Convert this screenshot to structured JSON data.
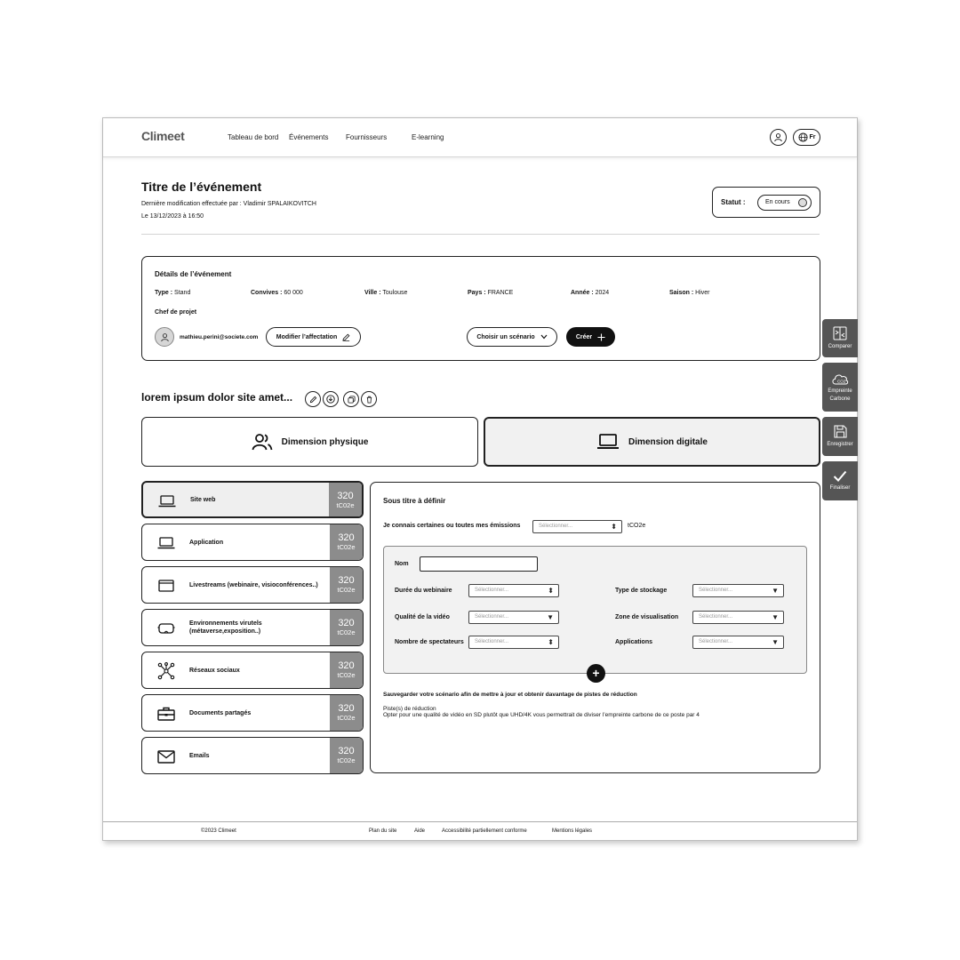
{
  "header": {
    "logo": "Climeet",
    "nav": [
      "Tableau de bord",
      "Événements",
      "Fournisseurs",
      "E-learning"
    ],
    "lang": "Fr"
  },
  "event": {
    "title": "Titre de l’événement",
    "modified_by": "Dernière modification effectuée par : Vladimir SPALAIKOVITCH",
    "date": "Le 13/12/2023 à 16:50",
    "status_label": "Statut :",
    "status_value": "En cours"
  },
  "details": {
    "title": "Détails de l’événement",
    "items": [
      {
        "key": "Type :",
        "value": " Stand"
      },
      {
        "key": "Convives :",
        "value": " 60 000"
      },
      {
        "key": "Ville :",
        "value": " Toulouse"
      },
      {
        "key": "Pays :",
        "value": " FRANCE"
      },
      {
        "key": "Année :",
        "value": " 2024"
      },
      {
        "key": "Saison :",
        "value": " Hiver"
      }
    ],
    "chef_label": "Chef de projet",
    "email": "mathieu.perini@societe.com",
    "modify_label": "Modifier l’affectation",
    "scenario_label": "Choisir un scénario",
    "create_label": "Créer"
  },
  "scenario": {
    "title": "lorem ipsum dolor site amet..."
  },
  "dimensions": {
    "physique": "Dimension physique",
    "digitale": "Dimension digitale"
  },
  "categories": [
    {
      "label": "Site web",
      "value": "320",
      "unit": "tC02e"
    },
    {
      "label": "Application",
      "value": "320",
      "unit": "tC02e"
    },
    {
      "label": "Livestreams (webinaire, visioconférences..)",
      "value": "320",
      "unit": "tC02e"
    },
    {
      "label": "Environnements virutels (métaverse,exposition..)",
      "value": "320",
      "unit": "tC02e"
    },
    {
      "label": "Réseaux sociaux",
      "value": "320",
      "unit": "tC02e"
    },
    {
      "label": "Documents partagés",
      "value": "320",
      "unit": "tC02e"
    },
    {
      "label": "Emails",
      "value": "320",
      "unit": "tC02e"
    }
  ],
  "panel": {
    "subtitle": "Sous titre à définir",
    "know_label": "Je connais certaines ou toutes mes émissions",
    "select_placeholder": "Sélectionner...",
    "unit": "tCO2e",
    "nom_label": "Nom",
    "fields": {
      "duree": "Durée du webinaire",
      "qualite": "Qualité de la vidéo",
      "spectateurs": "Nombre de spectateurs",
      "stockage": "Type de stockage",
      "zone": "Zone de visualisation",
      "applications": "Applications"
    },
    "field_placeholder": "Sélectionner...",
    "save_text": "Sauvegarder votre scénario afin de mettre à jour et obtenir davantage de pistes de réduction",
    "piste_title": "Piste(s) de réduction",
    "piste_text": "Opter pour une qualité de vidéo en SD plutôt que UHD/4K vous permettrait de diviser l’empreinte carbone de ce poste par 4"
  },
  "footer": {
    "copyright": "©2023 Climeet",
    "links": [
      "Plan du site",
      "Aide",
      "Accessibilité partiellement conforme",
      "Mentions légales"
    ]
  },
  "side": {
    "compare": "Comparer",
    "footprint_1": "Empreinte",
    "footprint_2": "Carbone",
    "save": "Enregistrer",
    "finalize": "Finaliser"
  }
}
